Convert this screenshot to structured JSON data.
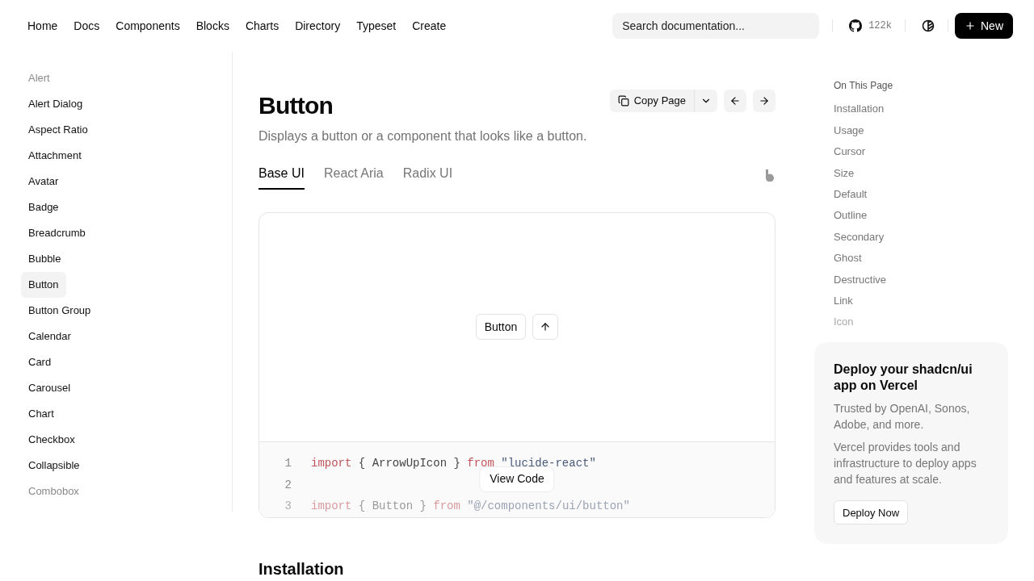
{
  "nav": {
    "links": [
      "Home",
      "Docs",
      "Components",
      "Blocks",
      "Charts",
      "Directory",
      "Typeset",
      "Create"
    ],
    "search": {
      "placeholder": "Search documentation..."
    },
    "stars": "122k",
    "new_button": "New"
  },
  "sidebar": {
    "items": [
      {
        "label": "Alert",
        "selected": false,
        "faded": true
      },
      {
        "label": "Alert Dialog",
        "selected": false,
        "faded": false
      },
      {
        "label": "Aspect Ratio",
        "selected": false,
        "faded": false
      },
      {
        "label": "Attachment",
        "selected": false,
        "faded": false
      },
      {
        "label": "Avatar",
        "selected": false,
        "faded": false
      },
      {
        "label": "Badge",
        "selected": false,
        "faded": false
      },
      {
        "label": "Breadcrumb",
        "selected": false,
        "faded": false
      },
      {
        "label": "Bubble",
        "selected": false,
        "faded": false
      },
      {
        "label": "Button",
        "selected": true,
        "faded": false
      },
      {
        "label": "Button Group",
        "selected": false,
        "faded": false
      },
      {
        "label": "Calendar",
        "selected": false,
        "faded": false
      },
      {
        "label": "Card",
        "selected": false,
        "faded": false
      },
      {
        "label": "Carousel",
        "selected": false,
        "faded": false
      },
      {
        "label": "Chart",
        "selected": false,
        "faded": false
      },
      {
        "label": "Checkbox",
        "selected": false,
        "faded": false
      },
      {
        "label": "Collapsible",
        "selected": false,
        "faded": false
      },
      {
        "label": "Combobox",
        "selected": false,
        "faded": true
      }
    ]
  },
  "page": {
    "title": "Button",
    "description": "Displays a button or a component that looks like a button.",
    "copy_button": "Copy Page",
    "tabs": [
      {
        "label": "Base UI",
        "selected": true
      },
      {
        "label": "React Aria",
        "selected": false
      },
      {
        "label": "Radix UI",
        "selected": false
      }
    ],
    "preview": {
      "button": "Button"
    },
    "code": {
      "lines": [
        {
          "number": "1",
          "faded": false,
          "tokens": [
            {
              "kind": "keyword",
              "text": "import"
            },
            {
              "kind": "plain",
              "text": " { ArrowUpIcon } "
            },
            {
              "kind": "keyword",
              "text": "from"
            },
            {
              "kind": "string",
              "text": " \"lucide-react\""
            }
          ]
        },
        {
          "number": "2",
          "faded": false
        },
        {
          "number": "3",
          "faded": true,
          "tokens": [
            {
              "kind": "keyword",
              "text": "import"
            },
            {
              "kind": "plain",
              "text": " { Button } "
            },
            {
              "kind": "keyword",
              "text": "from"
            },
            {
              "kind": "string",
              "text": " \"@/components/ui/button\""
            }
          ]
        }
      ],
      "view_button": "View Code"
    },
    "next_heading": "Installation"
  },
  "toc": {
    "title": "On This Page",
    "items": [
      {
        "label": "Installation",
        "faded": false
      },
      {
        "label": "Usage",
        "faded": false
      },
      {
        "label": "Cursor",
        "faded": false
      },
      {
        "label": "Size",
        "faded": false
      },
      {
        "label": "Default",
        "faded": false
      },
      {
        "label": "Outline",
        "faded": false
      },
      {
        "label": "Secondary",
        "faded": false
      },
      {
        "label": "Ghost",
        "faded": false
      },
      {
        "label": "Destructive",
        "faded": false
      },
      {
        "label": "Link",
        "faded": false
      },
      {
        "label": "Icon",
        "faded": true
      }
    ]
  },
  "promo": {
    "title": "Deploy your shadcn/ui app on Vercel",
    "text_1": "Trusted by OpenAI, Sonos, Adobe, and more.",
    "text_2": "Vercel provides tools and infrastructure to deploy apps and features at scale.",
    "button": "Deploy Now"
  }
}
